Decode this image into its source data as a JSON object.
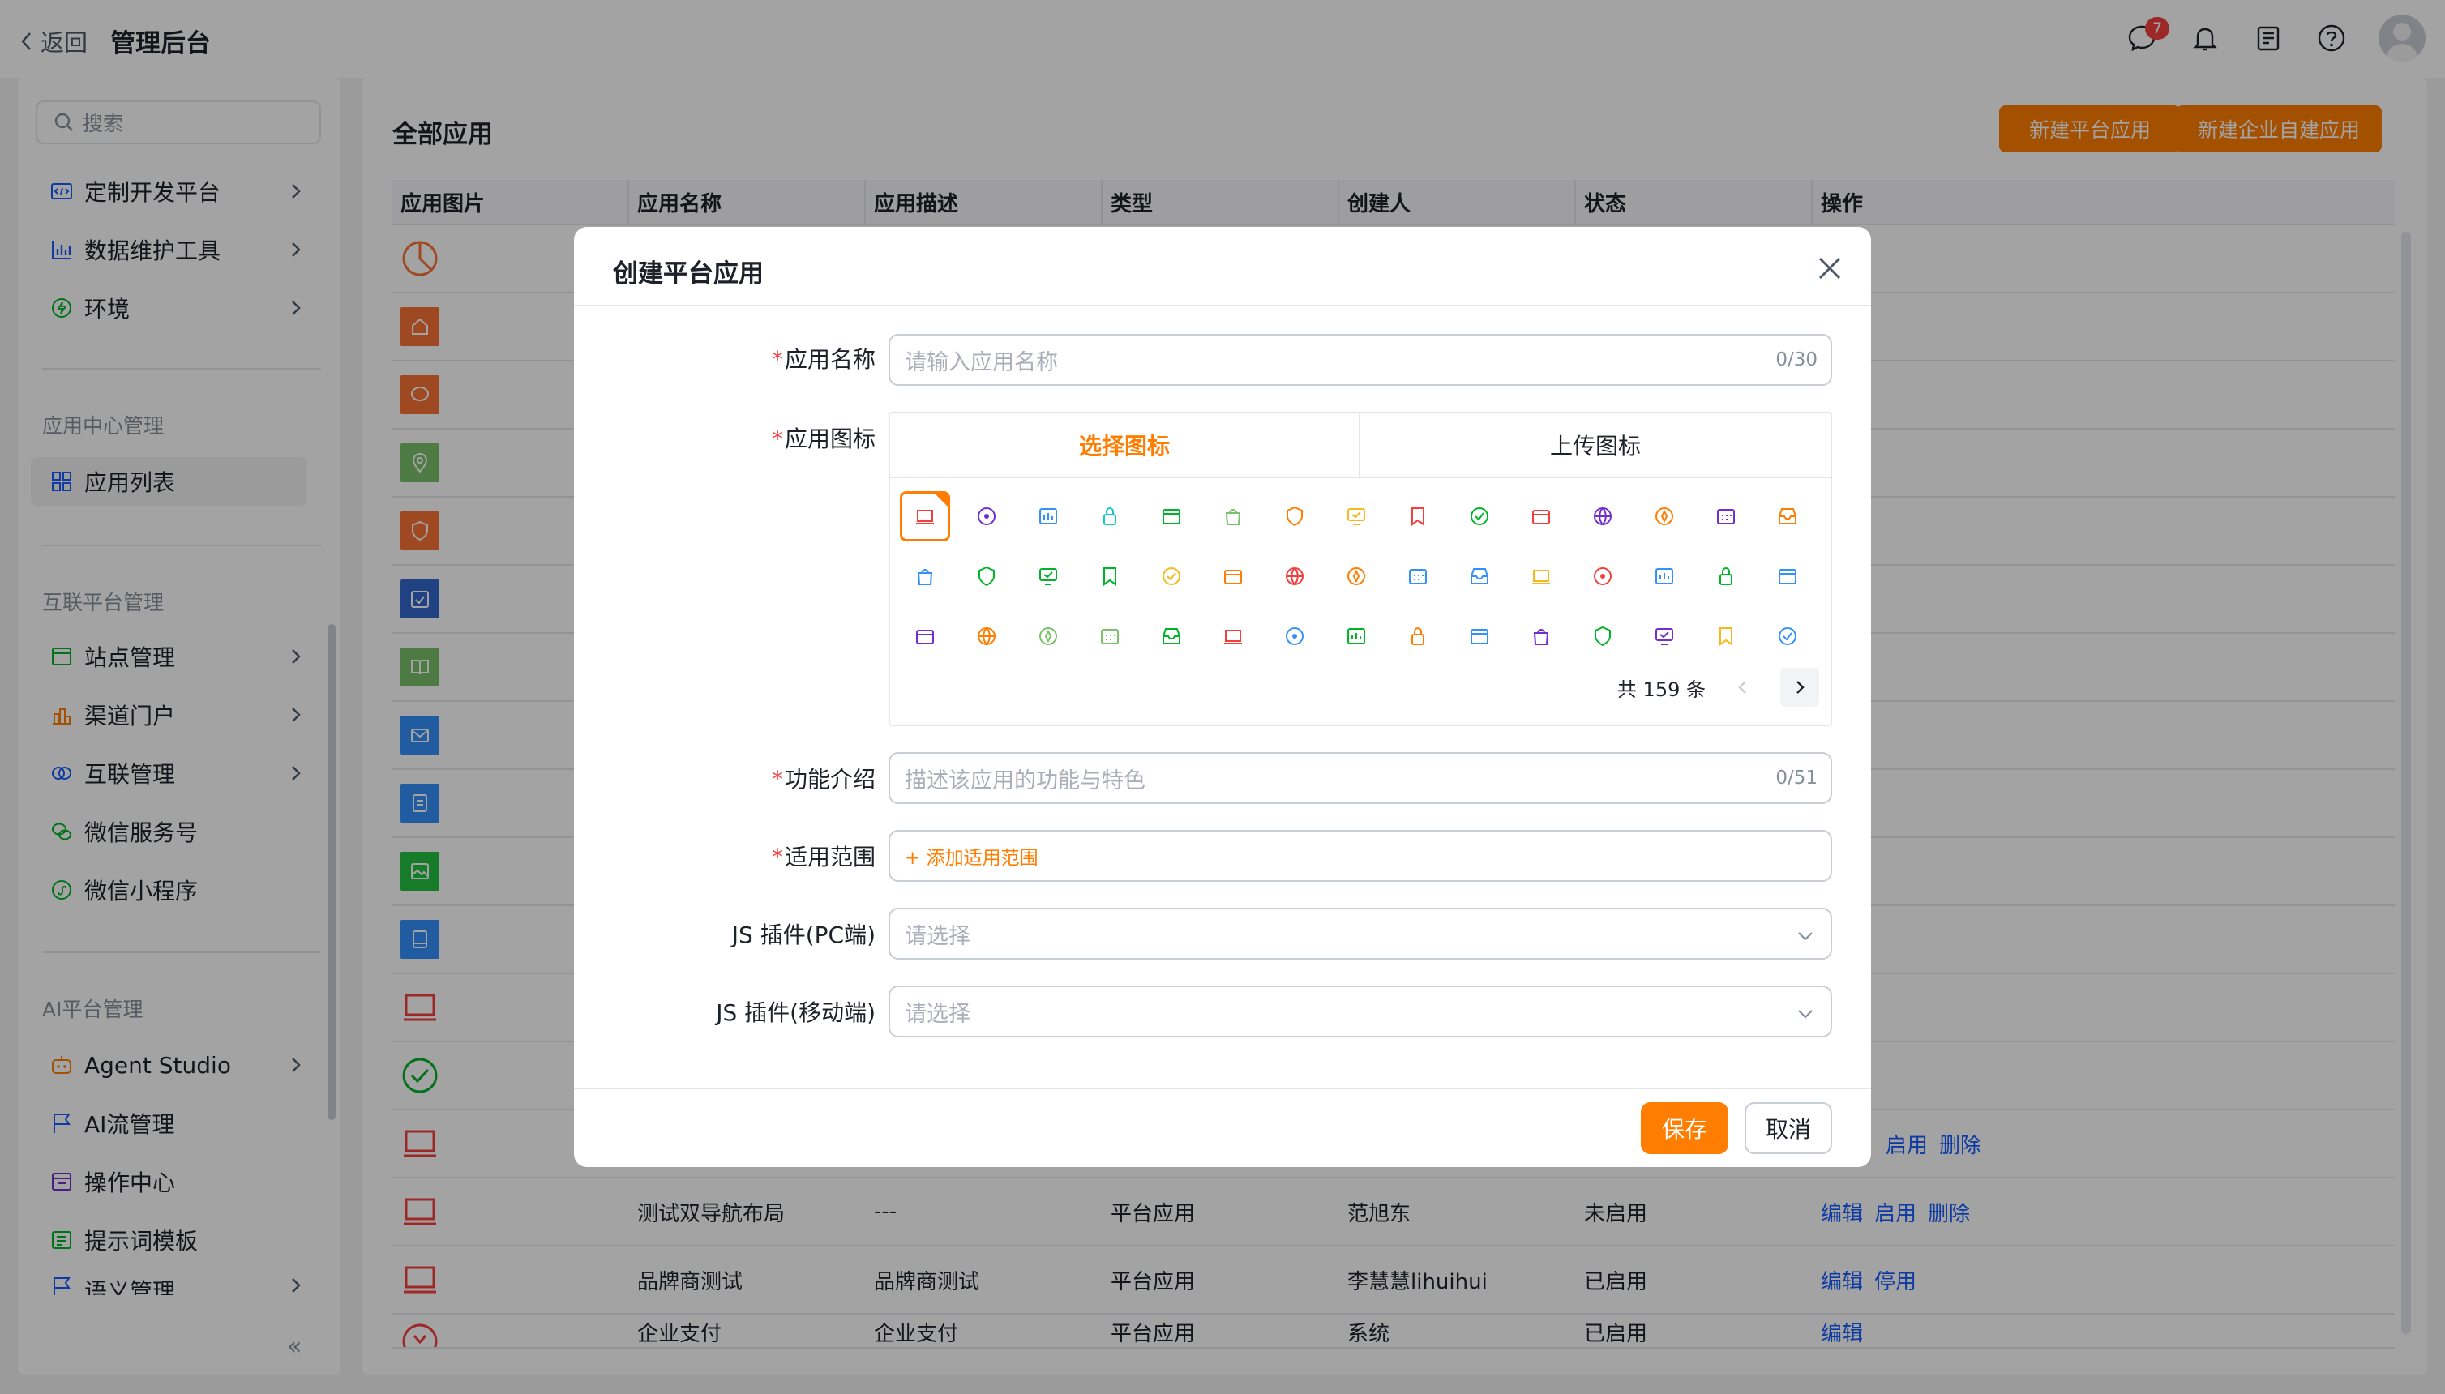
{
  "topbar": {
    "back_label": "返回",
    "title": "管理后台",
    "message_badge": "7"
  },
  "sidebar": {
    "search_placeholder": "搜索",
    "items_top": [
      {
        "label": "定制开发平台",
        "icon": "code-window-icon"
      },
      {
        "label": "数据维护工具",
        "icon": "bar-chart-icon"
      },
      {
        "label": "环境",
        "icon": "environment-icon"
      }
    ],
    "group_app_center": "应用中心管理",
    "app_list_label": "应用列表",
    "group_interconnect": "互联平台管理",
    "items_interconnect": [
      {
        "label": "站点管理",
        "icon": "site-icon"
      },
      {
        "label": "渠道门户",
        "icon": "portal-icon"
      },
      {
        "label": "互联管理",
        "icon": "link-icon"
      },
      {
        "label": "微信服务号",
        "icon": "wechat-icon"
      },
      {
        "label": "微信小程序",
        "icon": "miniprogram-icon"
      }
    ],
    "group_ai": "AI平台管理",
    "items_ai": [
      {
        "label": "Agent Studio",
        "icon": "robot-icon"
      },
      {
        "label": "AI流管理",
        "icon": "flag-icon"
      },
      {
        "label": "操作中心",
        "icon": "operation-icon"
      },
      {
        "label": "提示词模板",
        "icon": "template-icon"
      },
      {
        "label": "语义管理",
        "icon": "semantic-icon"
      }
    ],
    "collapse_glyph": "«"
  },
  "main": {
    "title": "全部应用",
    "btn_new_platform": "新建平台应用",
    "btn_new_enterprise": "新建企业自建应用",
    "columns": [
      "应用图片",
      "应用名称",
      "应用描述",
      "类型",
      "创建人",
      "状态",
      "操作"
    ],
    "rows": [
      {
        "name": "测试双导航布局",
        "desc": "---",
        "type": "平台应用",
        "creator": "范旭东",
        "status": "未启用",
        "actions": [
          "编辑",
          "启用",
          "删除"
        ]
      },
      {
        "name": "品牌商测试",
        "desc": "品牌商测试",
        "type": "平台应用",
        "creator": "李慧慧lihuihui",
        "status": "已启用",
        "actions": [
          "编辑",
          "停用"
        ]
      },
      {
        "name": "企业支付",
        "desc": "企业支付",
        "type": "平台应用",
        "creator": "系统",
        "status": "已启用",
        "actions": [
          "编辑"
        ]
      }
    ],
    "partial_actions_row": [
      "启用",
      "删除"
    ]
  },
  "modal": {
    "title": "创建平台应用",
    "name_label": "应用名称",
    "name_placeholder": "请输入应用名称",
    "name_count": "0/30",
    "icon_label": "应用图标",
    "tab_select": "选择图标",
    "tab_upload": "上传图标",
    "total_text": "共 159 条",
    "desc_label": "功能介绍",
    "desc_placeholder": "描述该应用的功能与特色",
    "desc_count": "0/51",
    "scope_label": "适用范围",
    "scope_add": "+ 添加适用范围",
    "js_pc_label": "JS 插件(PC端)",
    "js_pc_placeholder": "请选择",
    "js_mobile_label": "JS 插件(移动端)",
    "js_mobile_placeholder": "请选择",
    "save": "保存",
    "cancel": "取消"
  },
  "colors": {
    "accent": "#ff7d00",
    "link": "#165dff",
    "required": "#f53f3f"
  }
}
